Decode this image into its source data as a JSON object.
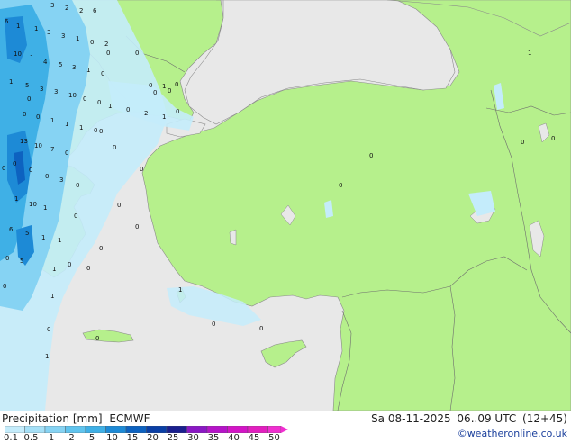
{
  "header": {
    "title": "Precipitation [mm]",
    "model": "ECMWF",
    "date": "Sa 08-11-2025",
    "time_range": "06..09 UTC",
    "lead": "(12+45)"
  },
  "credit": "©weatheronline.co.uk",
  "legend": {
    "ticks": [
      "0.1",
      "0.5",
      "1",
      "2",
      "5",
      "10",
      "15",
      "20",
      "25",
      "30",
      "35",
      "40",
      "45",
      "50"
    ],
    "colors": [
      "#c4ecfb",
      "#a5e0f7",
      "#86d3f3",
      "#60c4ee",
      "#3fb0e6",
      "#1d8ad6",
      "#0d62c0",
      "#0a3fa5",
      "#1a1f8e",
      "#8a18c4",
      "#b514c8",
      "#d315c6",
      "#e21fbf",
      "#f02fd0"
    ]
  },
  "map_values": [
    {
      "id": "v1",
      "text": "3"
    },
    {
      "id": "v2",
      "text": "2"
    },
    {
      "id": "v3",
      "text": "2"
    },
    {
      "id": "v4",
      "text": "6"
    },
    {
      "id": "v5",
      "text": "6"
    },
    {
      "id": "v6",
      "text": "1"
    },
    {
      "id": "v7",
      "text": "1"
    },
    {
      "id": "v8",
      "text": "3"
    },
    {
      "id": "v9",
      "text": "3"
    },
    {
      "id": "v10",
      "text": "1"
    },
    {
      "id": "v11",
      "text": "0"
    },
    {
      "id": "v12",
      "text": "2"
    },
    {
      "id": "v13",
      "text": "10"
    },
    {
      "id": "v14",
      "text": "1"
    },
    {
      "id": "v15",
      "text": "4"
    },
    {
      "id": "v16",
      "text": "5"
    },
    {
      "id": "v17",
      "text": "3"
    },
    {
      "id": "v18",
      "text": "1"
    },
    {
      "id": "v19",
      "text": "0"
    },
    {
      "id": "v20",
      "text": "1"
    },
    {
      "id": "v21",
      "text": "5"
    },
    {
      "id": "v22",
      "text": "3"
    },
    {
      "id": "v23",
      "text": "3"
    },
    {
      "id": "v24",
      "text": "10"
    },
    {
      "id": "v25",
      "text": "0"
    },
    {
      "id": "v26",
      "text": "0"
    },
    {
      "id": "v27",
      "text": "1"
    },
    {
      "id": "v28",
      "text": "0"
    },
    {
      "id": "v29",
      "text": "0"
    },
    {
      "id": "v30",
      "text": "1"
    },
    {
      "id": "v31",
      "text": "1"
    },
    {
      "id": "v32",
      "text": "1"
    },
    {
      "id": "v33",
      "text": "0"
    },
    {
      "id": "v34",
      "text": "0"
    },
    {
      "id": "v35",
      "text": "2"
    },
    {
      "id": "v36",
      "text": "1"
    },
    {
      "id": "v37",
      "text": "0"
    },
    {
      "id": "v38",
      "text": "1"
    },
    {
      "id": "v39",
      "text": "0"
    },
    {
      "id": "v40",
      "text": "13"
    },
    {
      "id": "v41",
      "text": "10"
    },
    {
      "id": "v42",
      "text": "7"
    },
    {
      "id": "v43",
      "text": "0"
    },
    {
      "id": "v44",
      "text": "0"
    },
    {
      "id": "v45",
      "text": "0"
    },
    {
      "id": "v46",
      "text": "0"
    },
    {
      "id": "v47",
      "text": "3"
    },
    {
      "id": "v48",
      "text": "0"
    },
    {
      "id": "v49",
      "text": "10"
    },
    {
      "id": "v50",
      "text": "1"
    },
    {
      "id": "v51",
      "text": "1"
    },
    {
      "id": "v52",
      "text": "0"
    },
    {
      "id": "v53",
      "text": "6"
    },
    {
      "id": "v54",
      "text": "5"
    },
    {
      "id": "v55",
      "text": "1"
    },
    {
      "id": "v56",
      "text": "1"
    },
    {
      "id": "v57",
      "text": "0"
    },
    {
      "id": "v58",
      "text": "5"
    },
    {
      "id": "v59",
      "text": "1"
    },
    {
      "id": "v60",
      "text": "0"
    },
    {
      "id": "v61",
      "text": "0"
    },
    {
      "id": "v62",
      "text": "1"
    },
    {
      "id": "v63",
      "text": "0"
    },
    {
      "id": "v64",
      "text": "0"
    },
    {
      "id": "v65",
      "text": "1"
    },
    {
      "id": "v66",
      "text": "1"
    },
    {
      "id": "v67",
      "text": "0"
    },
    {
      "id": "v68",
      "text": "0"
    },
    {
      "id": "v69",
      "text": "0"
    },
    {
      "id": "v70",
      "text": "0"
    },
    {
      "id": "v71",
      "text": "0"
    },
    {
      "id": "v72",
      "text": "0"
    },
    {
      "id": "v73",
      "text": "0"
    },
    {
      "id": "v74",
      "text": "0"
    },
    {
      "id": "v75",
      "text": "0"
    },
    {
      "id": "v76",
      "text": "1"
    },
    {
      "id": "v77",
      "text": "0"
    },
    {
      "id": "v78",
      "text": "0"
    },
    {
      "id": "v79",
      "text": "0"
    },
    {
      "id": "v80",
      "text": "0"
    },
    {
      "id": "v81",
      "text": "0"
    },
    {
      "id": "v82",
      "text": "0"
    },
    {
      "id": "v83",
      "text": "0"
    },
    {
      "id": "v84",
      "text": "0"
    },
    {
      "id": "v85",
      "text": "0"
    },
    {
      "id": "v86",
      "text": "0"
    },
    {
      "id": "v87",
      "text": "0"
    }
  ]
}
